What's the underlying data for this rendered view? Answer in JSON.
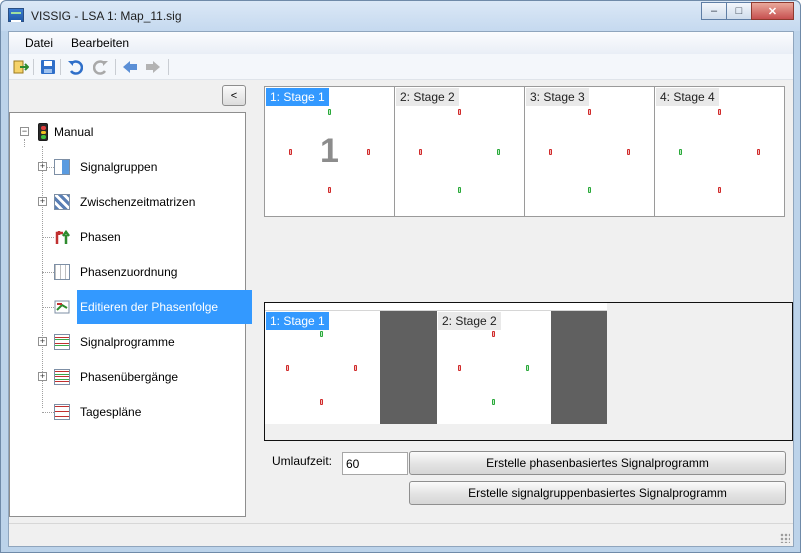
{
  "window": {
    "title": "VISSIG - LSA 1: Map_11.sig",
    "controls": {
      "minimize": "–",
      "maximize": "□",
      "close": "✕"
    }
  },
  "menu": [
    "Datei",
    "Bearbeiten"
  ],
  "toolbar": {
    "icons": [
      "exit-icon",
      "save-icon",
      "undo-icon",
      "redo-icon",
      "back-arrow-icon",
      "forward-arrow-icon"
    ]
  },
  "collapse_button": "<",
  "tree": {
    "root": "Manual",
    "items": [
      {
        "label": "Signalgruppen",
        "expandable": true
      },
      {
        "label": "Zwischenzeitmatrizen",
        "expandable": true
      },
      {
        "label": "Phasen",
        "expandable": false
      },
      {
        "label": "Phasenzuordnung",
        "expandable": false
      },
      {
        "label": "Editieren der Phasenfolge",
        "expandable": false,
        "selected": true
      },
      {
        "label": "Signalprogramme",
        "expandable": true
      },
      {
        "label": "Phasenübergänge",
        "expandable": true
      },
      {
        "label": "Tagespläne",
        "expandable": false
      }
    ]
  },
  "stages": [
    {
      "label": "1: Stage 1",
      "active": true,
      "number": "1"
    },
    {
      "label": "2: Stage 2",
      "active": false
    },
    {
      "label": "3: Stage 3",
      "active": false
    },
    {
      "label": "4: Stage 4",
      "active": false
    }
  ],
  "sequence": [
    {
      "label": "1: Stage 1",
      "active": true
    },
    {
      "label": "2: Stage 2",
      "active": false
    }
  ],
  "umlaufzeit": {
    "label": "Umlaufzeit:",
    "value": "60"
  },
  "buttons": {
    "phase_based": "Erstelle phasenbasiertes Signalprogramm",
    "group_based": "Erstelle signalgruppenbasiertes Signalprogramm"
  },
  "colors": {
    "selection": "#3399ff",
    "signal_red": "#d02a2a",
    "signal_green": "#2aa83a",
    "intergreen": "#606060"
  }
}
